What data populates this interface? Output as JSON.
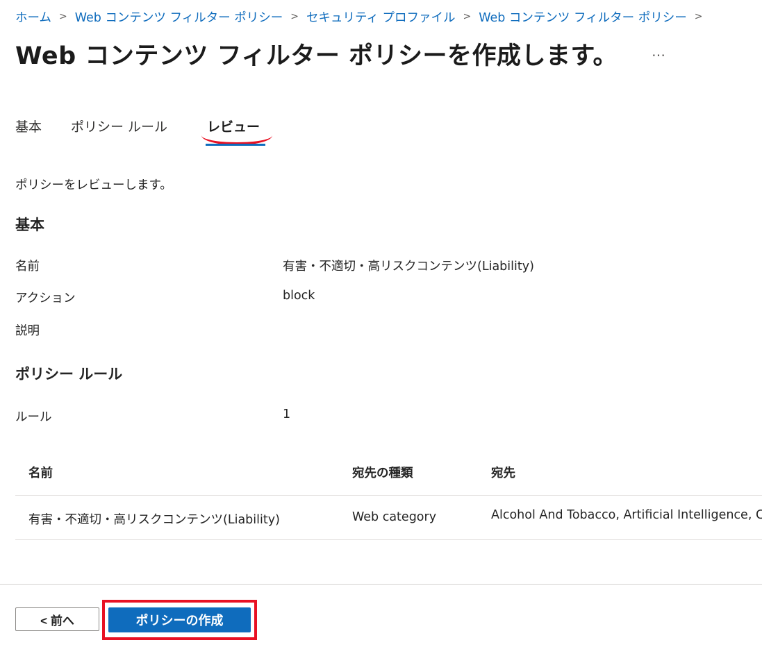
{
  "breadcrumb": [
    {
      "label": "ホーム"
    },
    {
      "label": "Web コンテンツ フィルター ポリシー"
    },
    {
      "label": "セキュリティ プロファイル"
    },
    {
      "label": "Web コンテンツ フィルター ポリシー"
    }
  ],
  "page": {
    "title": "Web コンテンツ フィルター ポリシーを作成します。",
    "more_label": "…"
  },
  "tabs": [
    {
      "label": "基本"
    },
    {
      "label": "ポリシー ルール"
    },
    {
      "label": "レビュー",
      "active": true
    }
  ],
  "review": {
    "intro": "ポリシーをレビューします。",
    "basics": {
      "heading": "基本",
      "fields": [
        {
          "label": "名前",
          "value": "有害・不適切・高リスクコンテンツ(Liability)"
        },
        {
          "label": "アクション",
          "value": "block"
        },
        {
          "label": "説明",
          "value": ""
        }
      ]
    },
    "rules": {
      "heading": "ポリシー ルール",
      "count_label": "ルール",
      "count_value": "1",
      "table": {
        "columns": [
          "名前",
          "宛先の種類",
          "宛先"
        ],
        "rows": [
          [
            "有害・不適切・高リスクコンテンツ(Liability)",
            "Web category",
            "Alcohol And Tobacco, Artificial Intelligence, C"
          ]
        ]
      }
    }
  },
  "footer": {
    "back_label": "< 前へ",
    "create_label": "ポリシーの作成"
  },
  "colors": {
    "accent": "#0f6cbd",
    "highlight": "#e81123"
  }
}
